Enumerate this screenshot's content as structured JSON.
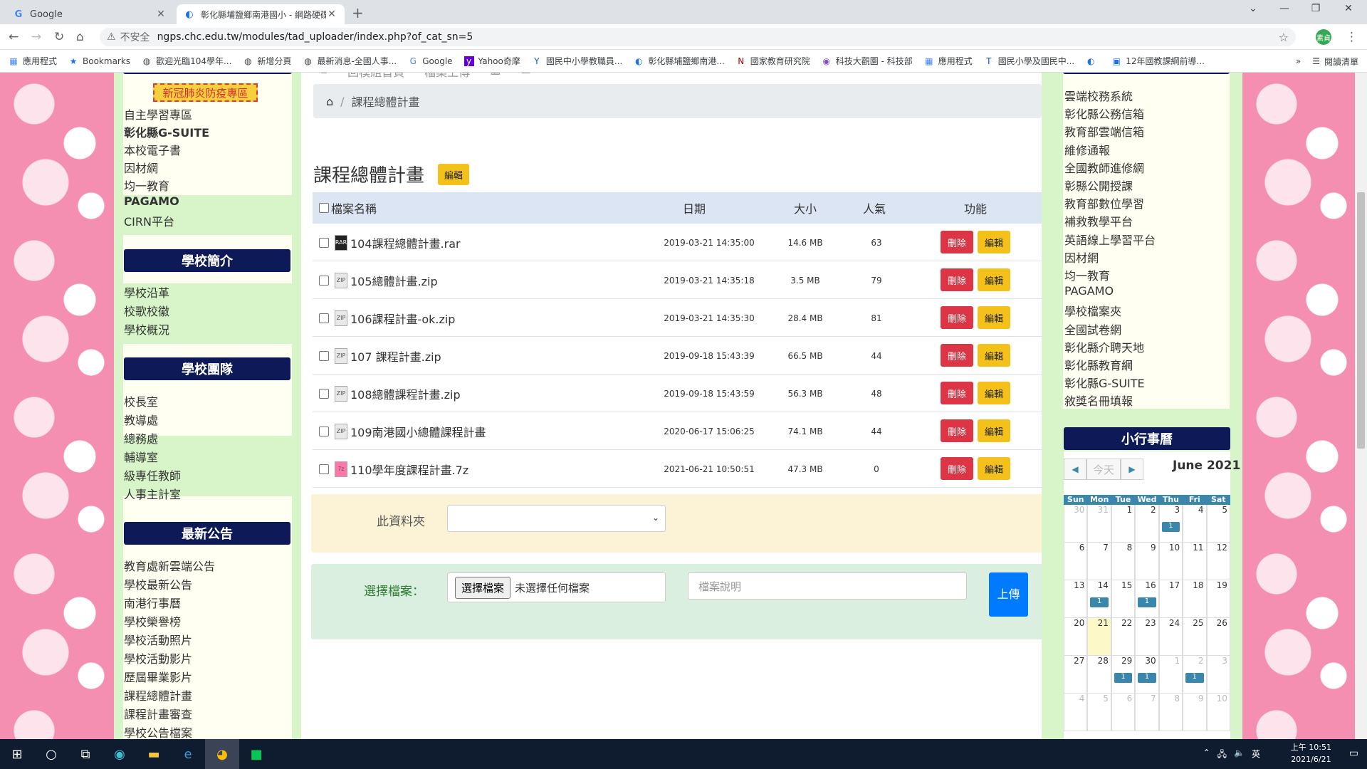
{
  "browser": {
    "tabs": [
      {
        "title": "Google",
        "icon": "google-favicon"
      },
      {
        "title": "彰化縣埔鹽鄉南港國小 - 網路硬碟",
        "icon": "site-favicon"
      }
    ],
    "address": {
      "security": "不安全",
      "url": "ngps.chc.edu.tw/modules/tad_uploader/index.php?of_cat_sn=5"
    },
    "profile": "素貞",
    "bookmarks": [
      "應用程式",
      "Bookmarks",
      "歡迎光臨104學年...",
      "新增分頁",
      "最新消息-全國人事...",
      "Google",
      "Yahoo奇摩",
      "國民中小學教職員...",
      "彰化縣埔鹽鄉南港...",
      "國家教育研究院",
      "科技大觀園 - 科技部",
      "應用程式",
      "國民小學及國民中...",
      "12年國教課綱前導..."
    ],
    "reading_list": "閱讀清單"
  },
  "left": {
    "covid": "新冠肺炎防疫專區",
    "links1": [
      {
        "t": "自主學習專區",
        "b": false
      },
      {
        "t": "彰化縣G-SUITE",
        "b": true
      },
      {
        "t": "本校電子書",
        "b": false
      },
      {
        "t": "因材網",
        "b": false
      },
      {
        "t": "均一教育",
        "b": false
      },
      {
        "t": "PAGAMO",
        "b": true
      },
      {
        "t": "CIRN平台",
        "b": false
      }
    ],
    "head_intro": "學校簡介",
    "intro": [
      "學校沿革",
      "校歌校徽",
      "學校概況"
    ],
    "head_team": "學校團隊",
    "team": [
      "校長室",
      "教導處",
      "總務處",
      "輔導室",
      "級專任教師",
      "人事主計室"
    ],
    "head_news": "最新公告",
    "news": [
      "教育處新雲端公告",
      "學校最新公告",
      "南港行事曆",
      "學校榮譽榜",
      "學校活動照片",
      "學校活動影片",
      "歷屆畢業影片",
      "課程總體計畫",
      "課程計畫審查",
      "學校公告檔案"
    ]
  },
  "main": {
    "topnav": [
      "回模組首頁",
      "檔案上傳"
    ],
    "breadcrumb": "課程總體計畫",
    "title": "課程總體計畫",
    "edit_label": "編輯",
    "columns": {
      "name": "檔案名稱",
      "date": "日期",
      "size": "大小",
      "hits": "人氣",
      "func": "功能"
    },
    "files": [
      {
        "name": "104課程總體計畫.rar",
        "date": "2019-03-21 14:35:00",
        "size": "14.6 MB",
        "hits": "63",
        "icon": "rar-file-icon"
      },
      {
        "name": "105總體計畫.zip",
        "date": "2019-03-21 14:35:18",
        "size": "3.5 MB",
        "hits": "79",
        "icon": "zip-file-icon"
      },
      {
        "name": "106課程計畫-ok.zip",
        "date": "2019-03-21 14:35:30",
        "size": "28.4 MB",
        "hits": "81",
        "icon": "zip-file-icon"
      },
      {
        "name": "107 課程計畫.zip",
        "date": "2019-09-18 15:43:39",
        "size": "66.5 MB",
        "hits": "44",
        "icon": "zip-file-icon"
      },
      {
        "name": "108總體課程計畫.zip",
        "date": "2019-09-18 15:43:59",
        "size": "56.3 MB",
        "hits": "48",
        "icon": "zip-file-icon"
      },
      {
        "name": "109南港國小總體課程計畫",
        "date": "2020-06-17 15:06:25",
        "size": "74.1 MB",
        "hits": "44",
        "icon": "zip-file-icon"
      },
      {
        "name": "110學年度課程計畫.7z",
        "date": "2021-06-21 10:50:51",
        "size": "47.3 MB",
        "hits": "0",
        "icon": "7z-file-icon"
      }
    ],
    "delete_label": "刪除",
    "folder_label": "此資料夾",
    "upload_label": "選擇檔案：",
    "choose_btn": "選擇檔案",
    "no_file": "未選擇任何檔案",
    "desc_placeholder": "檔案說明",
    "upload_btn": "上傳"
  },
  "right": {
    "links": [
      "雲端校務系統",
      "彰化縣公務信箱",
      "教育部雲端信箱",
      "維修通報",
      "全國教師進修網",
      "彰縣公開授課",
      "教育部數位學習",
      "補救教學平台",
      "英語線上學習平台",
      "因材網",
      "均一教育",
      "PAGAMO",
      "學校檔案夾",
      "全國試卷網",
      "彰化縣介聘天地",
      "彰化縣教育網",
      "彰化縣G-SUITE",
      "敘獎名冊填報"
    ],
    "cal_head": "小行事曆",
    "today_btn": "今天",
    "month": "June 2021",
    "dow": [
      "Sun",
      "Mon",
      "Tue",
      "Wed",
      "Thu",
      "Fri",
      "Sat"
    ]
  },
  "taskbar": {
    "time": "上午 10:51",
    "date": "2021/6/21",
    "ime": "英"
  }
}
